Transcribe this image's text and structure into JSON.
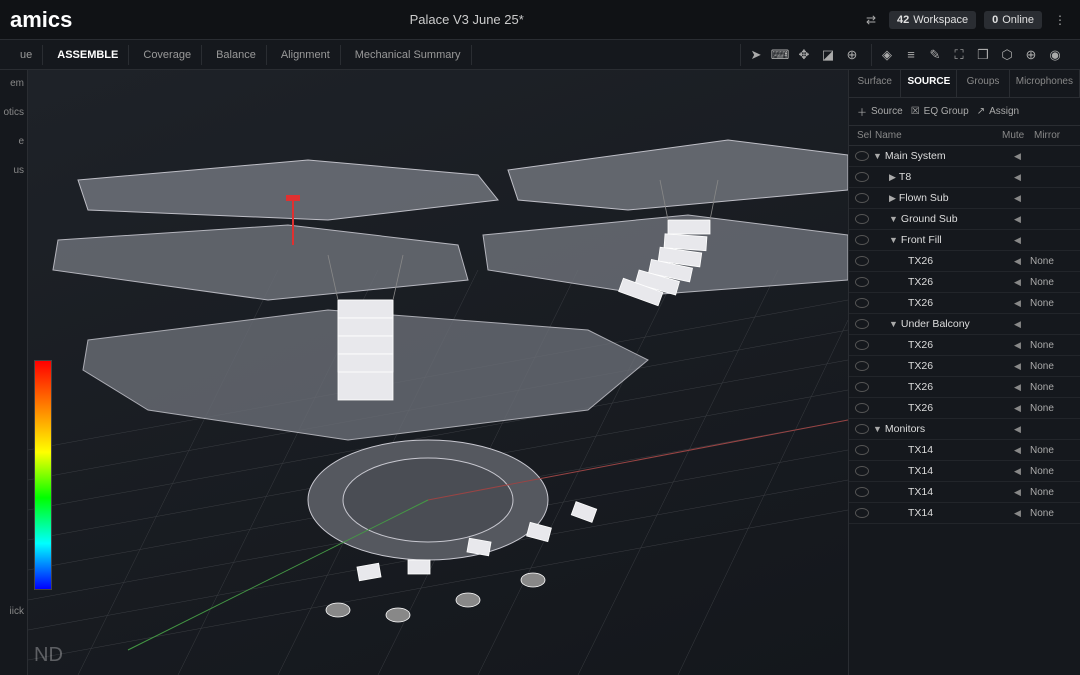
{
  "header": {
    "logo": "amics",
    "title": "Palace V3 June 25*",
    "workspace_count": "42",
    "workspace_label": "Workspace",
    "online_count": "0",
    "online_label": "Online"
  },
  "subbar": {
    "left_label": "ue",
    "tabs": [
      "ASSEMBLE",
      "Coverage",
      "Balance",
      "Alignment",
      "Mechanical Summary"
    ]
  },
  "left_sidebar": [
    "em",
    "otics",
    "e",
    "us",
    "iick"
  ],
  "watermark": "ND",
  "right_panel": {
    "tabs": [
      "Surface",
      "SOURCE",
      "Groups",
      "Microphones"
    ],
    "actions": {
      "source": "Source",
      "eqgroup": "EQ Group",
      "assign": "Assign"
    },
    "columns": {
      "sel": "Sel",
      "name": "Name",
      "mute": "Mute",
      "mirror": "Mirror"
    },
    "tree": [
      {
        "indent": 0,
        "toggle": "▼",
        "name": "Main System",
        "mirror": ""
      },
      {
        "indent": 1,
        "toggle": "▶",
        "name": "T8",
        "mirror": ""
      },
      {
        "indent": 1,
        "toggle": "▶",
        "name": "Flown Sub",
        "mirror": ""
      },
      {
        "indent": 1,
        "toggle": "▼",
        "name": "Ground Sub",
        "mirror": ""
      },
      {
        "indent": 1,
        "toggle": "▼",
        "name": "Front Fill",
        "mirror": ""
      },
      {
        "indent": 2,
        "toggle": "",
        "name": "TX26",
        "mirror": "None"
      },
      {
        "indent": 2,
        "toggle": "",
        "name": "TX26",
        "mirror": "None"
      },
      {
        "indent": 2,
        "toggle": "",
        "name": "TX26",
        "mirror": "None"
      },
      {
        "indent": 1,
        "toggle": "▼",
        "name": "Under Balcony",
        "mirror": ""
      },
      {
        "indent": 2,
        "toggle": "",
        "name": "TX26",
        "mirror": "None"
      },
      {
        "indent": 2,
        "toggle": "",
        "name": "TX26",
        "mirror": "None"
      },
      {
        "indent": 2,
        "toggle": "",
        "name": "TX26",
        "mirror": "None"
      },
      {
        "indent": 2,
        "toggle": "",
        "name": "TX26",
        "mirror": "None"
      },
      {
        "indent": 0,
        "toggle": "▼",
        "name": "Monitors",
        "mirror": ""
      },
      {
        "indent": 2,
        "toggle": "",
        "name": "TX14",
        "mirror": "None"
      },
      {
        "indent": 2,
        "toggle": "",
        "name": "TX14",
        "mirror": "None"
      },
      {
        "indent": 2,
        "toggle": "",
        "name": "TX14",
        "mirror": "None"
      },
      {
        "indent": 2,
        "toggle": "",
        "name": "TX14",
        "mirror": "None"
      }
    ]
  }
}
